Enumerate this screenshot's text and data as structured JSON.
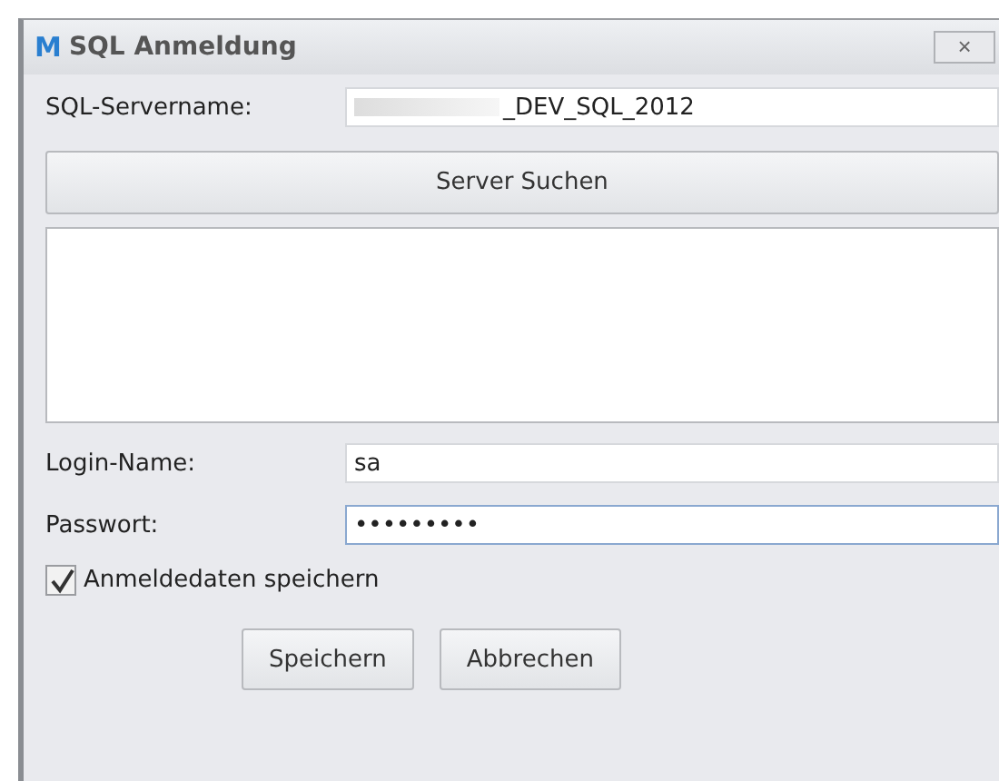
{
  "window": {
    "title": "SQL Anmeldung",
    "logo": "M",
    "close": "×"
  },
  "server": {
    "label": "SQL-Servername:",
    "value": "_DEV_SQL_2012",
    "redacted": true
  },
  "search_button": "Server Suchen",
  "login": {
    "label": "Login-Name:",
    "value": "sa"
  },
  "password": {
    "label": "Passwort:",
    "value": "•••••••••",
    "focused": true
  },
  "remember": {
    "label": "Anmeldedaten speichern",
    "checked": true
  },
  "buttons": [
    "Speichern",
    "Abbrechen"
  ]
}
